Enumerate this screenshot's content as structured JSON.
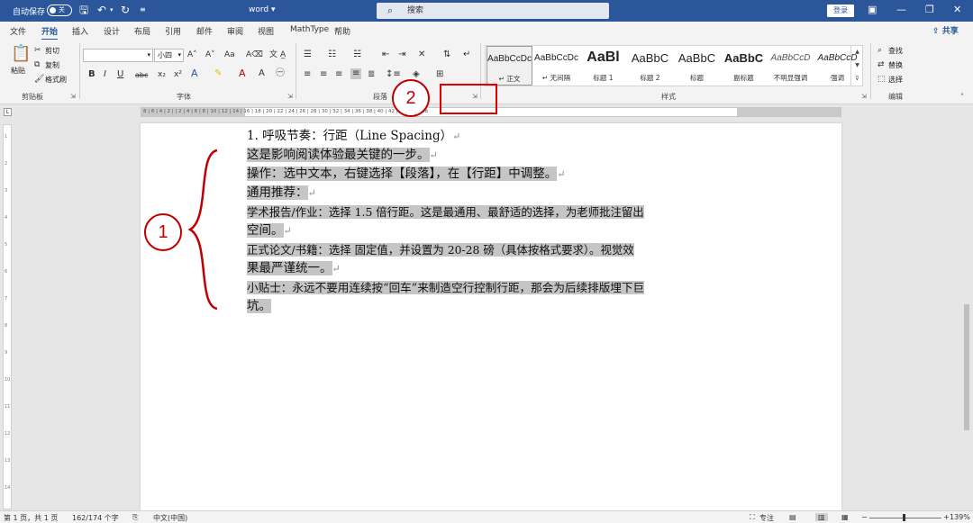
{
  "titlebar": {
    "autosave_label": "自动保存",
    "autosave_state": "关",
    "doc_name": "word ▾",
    "search_placeholder": "搜索",
    "login_label": "登录"
  },
  "tabs": [
    "文件",
    "开始",
    "插入",
    "设计",
    "布局",
    "引用",
    "邮件",
    "审阅",
    "视图",
    "MathType",
    "帮助"
  ],
  "active_tab": "开始",
  "share_label": "共享",
  "ribbon": {
    "clipboard": {
      "label": "剪贴板",
      "paste": "粘贴",
      "cut": "剪切",
      "copy": "复制",
      "format_painter": "格式刷"
    },
    "font": {
      "label": "字体",
      "font_name": "",
      "font_size": "小四",
      "buttons": [
        "B",
        "I",
        "U",
        "abc",
        "x₂",
        "x²"
      ]
    },
    "paragraph": {
      "label": "段落"
    },
    "styles": {
      "label": "样式",
      "items": [
        {
          "preview": "AaBbCcDc",
          "name": "↵ 正文"
        },
        {
          "preview": "AaBbCcDc",
          "name": "↵ 无间隔"
        },
        {
          "preview": "AaBl",
          "name": "标题 1"
        },
        {
          "preview": "AaBbC",
          "name": "标题 2"
        },
        {
          "preview": "AaBbC",
          "name": "标题"
        },
        {
          "preview": "AaBbC",
          "name": "副标题"
        },
        {
          "preview": "AaBbCcD",
          "name": "不明显强调"
        },
        {
          "preview": "AaBbCcD",
          "name": "强调"
        }
      ]
    },
    "editing": {
      "label": "编辑",
      "find": "查找",
      "replace": "替换",
      "select": "选择"
    }
  },
  "ruler_text": "8 | 6 | 4 | 2 |   | 2 | 4 | 6 | 8 | 10 | 12 | 14 | 16 | 18 | 20 | 22 | 24 | 26 | 28 | 30 | 32 | 34 | 36 | 38 | 40 | 42 | 44 | 46 | 48",
  "document": {
    "heading": "1. 呼吸节奏：行距（Line Spacing）",
    "lines": [
      "这是影响阅读体验最关键的一步。",
      "操作：选中文本，右键选择【段落】，在【行距】中调整。",
      "通用推荐：",
      "学术报告/作业：选择 1.5 倍行距。这是最通用、最舒适的选择，为老师批注留出",
      "空间。",
      "正式论文/书籍：选择 固定值，并设置为 20-28 磅（具体按格式要求）。视觉效",
      "果最严谨统一。",
      "小贴士：永远不要用连续按“回车”来制造空行控制行距，那会为后续排版埋下巨",
      "坑。"
    ],
    "paragraph_mark": "↵"
  },
  "annotations": {
    "circle_1": "1",
    "circle_2": "2"
  },
  "status": {
    "page": "第 1 页，共 1 页",
    "words": "162/174 个字",
    "language": "中文(中国)",
    "focus": "专注",
    "zoom": "139%"
  }
}
